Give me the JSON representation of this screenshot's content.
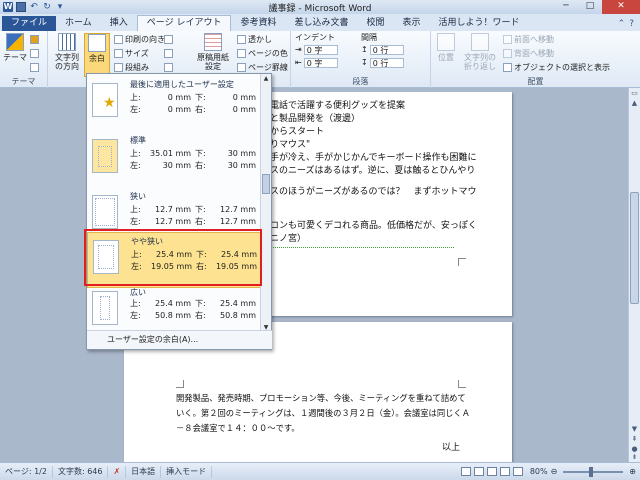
{
  "window": {
    "title": "議事録 - Microsoft Word"
  },
  "tabs": [
    "ファイル",
    "ホーム",
    "挿入",
    "ページ レイアウト",
    "参考資料",
    "差し込み文書",
    "校閲",
    "表示",
    "活用しよう！ワード"
  ],
  "ribbon": {
    "theme": {
      "label": "テーマ",
      "group": "テーマ"
    },
    "text_direction": "文字列の方向",
    "margins": "余白",
    "orientation": "印刷の向き",
    "size": "サイズ",
    "columns": "段組み",
    "manuscript": "原稿用紙設定",
    "watermark": "透かし",
    "page_color": "ページの色",
    "page_borders": "ページ罫線",
    "indent_label": "インデント",
    "indent_left": "0 字",
    "indent_right": "0 字",
    "spacing_label": "間隔",
    "spacing_before": "0 行",
    "spacing_after": "0 行",
    "paragraph_group": "段落",
    "position": "位置",
    "wrap_text": "文字列の折り返し",
    "bring_forward": "前面へ移動",
    "send_backward": "背面へ移動",
    "selection_pane": "オブジェクトの選択と表示",
    "arrange_group": "配置"
  },
  "margins_menu": {
    "options": [
      {
        "name": "最後に適用したユーザー設定",
        "top": "0 mm",
        "bottom": "0 mm",
        "left": "0 mm",
        "right": "0 mm"
      },
      {
        "name": "標準",
        "top": "35.01 mm",
        "bottom": "30 mm",
        "left": "30 mm",
        "right": "30 mm"
      },
      {
        "name": "狭い",
        "top": "12.7 mm",
        "bottom": "12.7 mm",
        "left": "12.7 mm",
        "right": "12.7 mm"
      },
      {
        "name": "やや狭い",
        "top": "25.4 mm",
        "bottom": "25.4 mm",
        "left": "19.05 mm",
        "right": "19.05 mm"
      },
      {
        "name": "広い",
        "top": "25.4 mm",
        "bottom": "25.4 mm",
        "left": "50.8 mm",
        "right": "50.8 mm"
      }
    ],
    "labels": {
      "top": "上:",
      "bottom": "下:",
      "left": "左:",
      "right": "右:"
    },
    "footer": "ユーザー設定の余白(A)..."
  },
  "document": {
    "page1_lines": [
      "電話で活躍する便利グッズを提案",
      "と製品開発を（渡邊）",
      "からスタート",
      "りマウス\"",
      "手が冷え、手がかじかんでキーボード操作も困難に",
      "スのニーズはあるはず。逆に、夏は触るとひんやり",
      "スのほうがニーズがあるのでは？　まずホットマウ",
      "コンも可愛くデコれる商品。低価格だが、安っぽく",
      "ニノ宮）"
    ],
    "page2_lines": [
      "開発製品、発売時期、プロモーション等、今後、ミーティングを重ねて詰めて",
      "いく。第２回のミーティングは、１週間後の３月２日（金）。会議室は同じくＡ",
      "－８会議室で１４：００～です。"
    ],
    "closing": "以上"
  },
  "status": {
    "page": "ページ: 1/2",
    "words": "文字数: 646",
    "language": "日本語",
    "mode": "挿入モード",
    "zoom": "80%"
  }
}
